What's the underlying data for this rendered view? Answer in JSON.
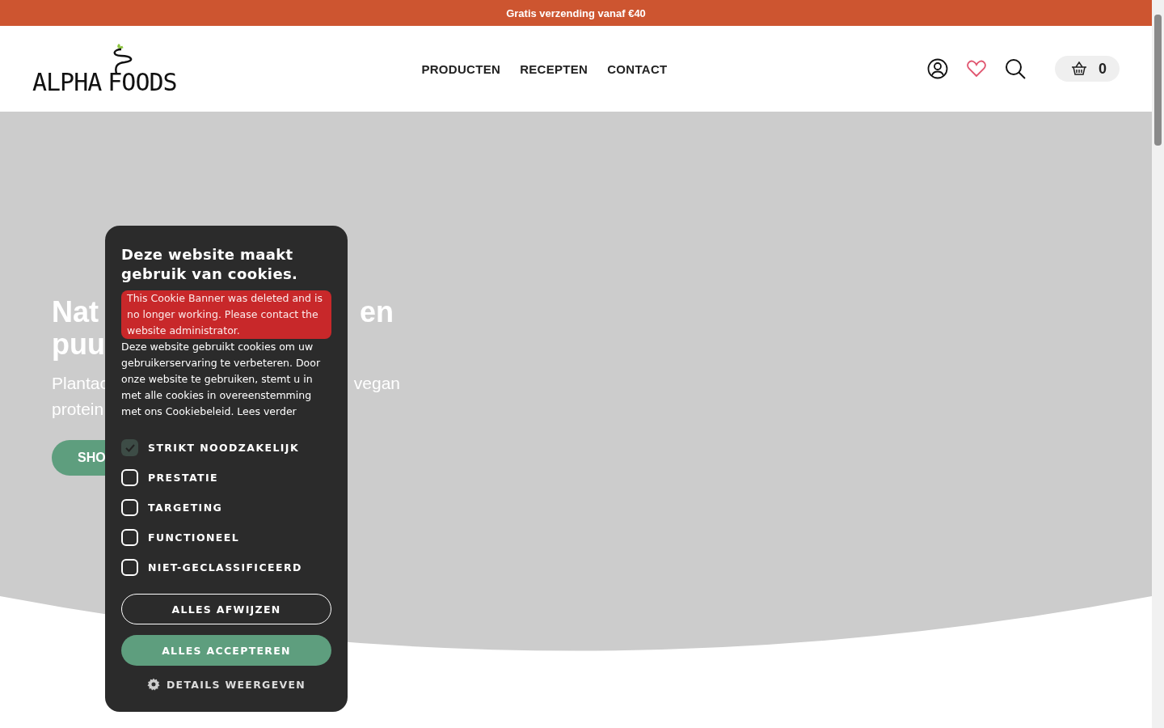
{
  "announcement": "Gratis verzending vanaf €40",
  "logo": {
    "text_left": "ALPHA",
    "text_right": "FOODS"
  },
  "nav": [
    {
      "label": "PRODUCTEN"
    },
    {
      "label": "RECEPTEN"
    },
    {
      "label": "CONTACT"
    }
  ],
  "cart": {
    "count": "0"
  },
  "hero": {
    "title_lines": [
      {
        "left": "Nat",
        "right": "en"
      },
      {
        "left": "puu"
      }
    ],
    "subtitle_lines": [
      {
        "left": "Plantac",
        "right": "vegan"
      },
      {
        "left": "protein"
      }
    ],
    "button": "SHO"
  },
  "cookie_dialog": {
    "title": "Deze website maakt gebruik van cookies.",
    "error": "This Cookie Banner was deleted and is no longer working. Please contact the website administrator.",
    "body": "Deze website gebruikt cookies om uw gebruikerservaring te verbeteren. Door onze website te gebruiken, stemt u in met alle cookies in overeenstemming met ons Cookiebeleid. Lees verder",
    "options": [
      {
        "label": "STRIKT NOODZAKELIJK",
        "checked": true
      },
      {
        "label": "PRESTATIE",
        "checked": false
      },
      {
        "label": "TARGETING",
        "checked": false
      },
      {
        "label": "FUNCTIONEEL",
        "checked": false
      },
      {
        "label": "NIET-GECLASSIFICEERD",
        "checked": false
      }
    ],
    "reject": "ALLES AFWIJZEN",
    "accept": "ALLES ACCEPTEREN",
    "details": "DETAILS WEERGEVEN"
  }
}
